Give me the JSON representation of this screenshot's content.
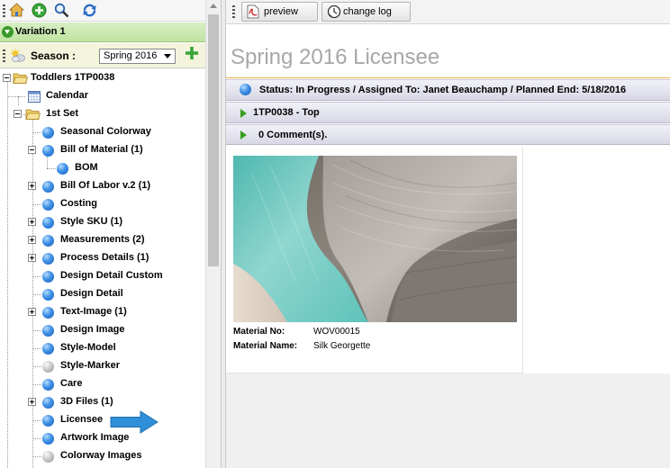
{
  "left_toolbar": {
    "icons": [
      "home-icon",
      "add-icon",
      "search-icon",
      "refresh-icon"
    ]
  },
  "variation": {
    "label": "Variation 1"
  },
  "season": {
    "label": "Season :",
    "selected": "Spring 2016"
  },
  "tree": {
    "root": {
      "label": "Toddlers    1TP0038"
    },
    "calendar": {
      "label": "Calendar"
    },
    "set": {
      "label": "1st Set"
    },
    "items": [
      {
        "label": "Seasonal Colorway",
        "status": "blue",
        "expander": "none"
      },
      {
        "label": "Bill of Material (1)",
        "status": "blue",
        "expander": "minus"
      },
      {
        "label": "BOM",
        "status": "blue",
        "expander": "none",
        "child": true
      },
      {
        "label": "Bill Of Labor v.2 (1)",
        "status": "blue",
        "expander": "plus"
      },
      {
        "label": "Costing",
        "status": "blue",
        "expander": "none"
      },
      {
        "label": "Style SKU (1)",
        "status": "blue",
        "expander": "plus"
      },
      {
        "label": "Measurements (2)",
        "status": "blue",
        "expander": "plus"
      },
      {
        "label": "Process Details (1)",
        "status": "blue",
        "expander": "plus"
      },
      {
        "label": "Design Detail Custom",
        "status": "blue",
        "expander": "none"
      },
      {
        "label": "Design Detail",
        "status": "blue",
        "expander": "none"
      },
      {
        "label": "Text-Image (1)",
        "status": "blue",
        "expander": "plus"
      },
      {
        "label": "Design Image",
        "status": "blue",
        "expander": "none"
      },
      {
        "label": "Style-Model",
        "status": "blue",
        "expander": "none"
      },
      {
        "label": "Style-Marker",
        "status": "grey",
        "expander": "none"
      },
      {
        "label": "Care",
        "status": "blue",
        "expander": "none"
      },
      {
        "label": "3D Files (1)",
        "status": "blue",
        "expander": "plus"
      },
      {
        "label": "Licensee",
        "status": "blue",
        "expander": "none"
      },
      {
        "label": "Artwork Image",
        "status": "blue",
        "expander": "none"
      },
      {
        "label": "Colorway Images",
        "status": "grey",
        "expander": "none"
      }
    ]
  },
  "right_toolbar": {
    "preview_label": "preview",
    "changelog_label": "change log"
  },
  "page": {
    "title": "Spring 2016 Licensee",
    "status_line": "Status: In Progress / Assigned To: Janet Beauchamp / Planned End: 5/18/2016",
    "section_style": "1TP0038 - Top",
    "section_comments": "0 Comment(s)."
  },
  "material": {
    "no_label": "Material No:",
    "no_value": "WOV00015",
    "name_label": "Material Name:",
    "name_value": "Silk Georgette"
  },
  "colors": {
    "variation_bar": "#bfe3a2",
    "title_rule": "#e8b04a",
    "status_ball": "#3d8fe6",
    "arrow": "#2f8fd8"
  }
}
